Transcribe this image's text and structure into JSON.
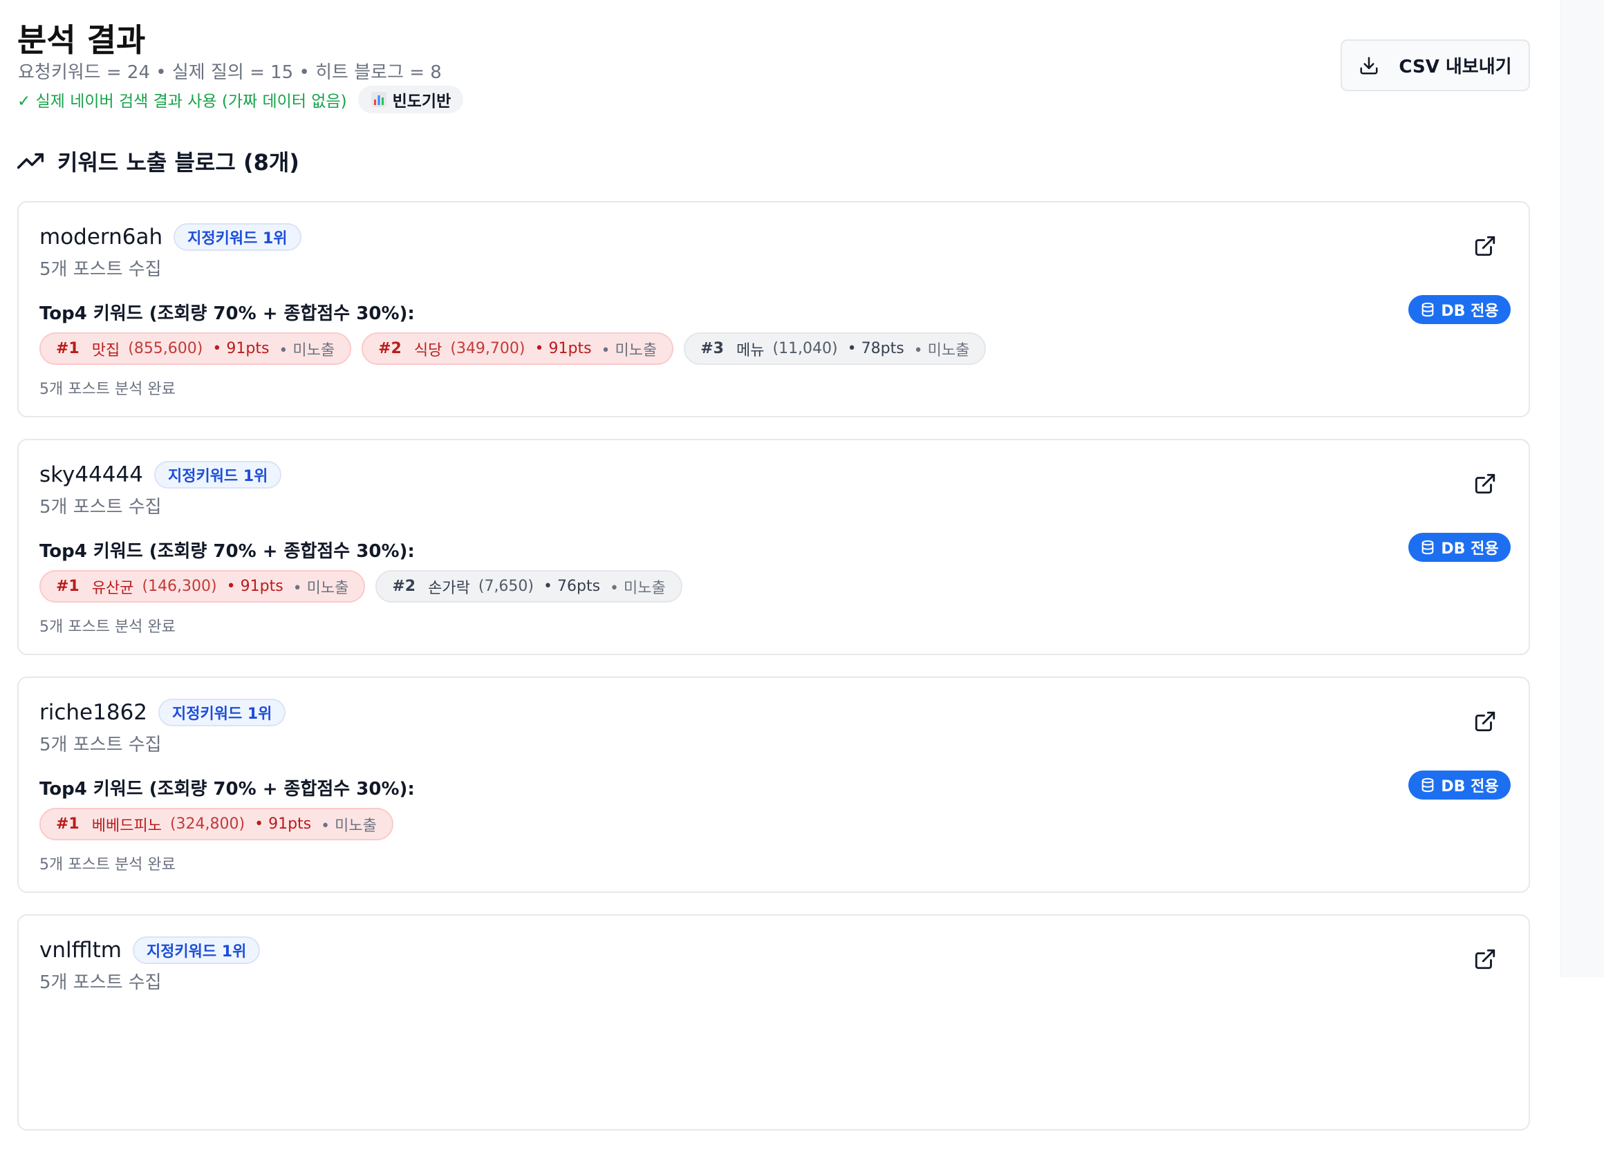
{
  "header": {
    "title": "분석 결과",
    "stats": "요청키워드 = 24 • 실제 질의 = 15 • 히트 블로그 = 8",
    "real_data_note": "✓ 실제 네이버 검색 결과 사용 (가짜 데이터 없음)",
    "frequency_chip": "빈도기반",
    "csv_button": "CSV 내보내기"
  },
  "section": {
    "title": "키워드 노출 블로그 (8개)",
    "icon": "trending-up-icon"
  },
  "blogs": [
    {
      "id": "modern6ah",
      "rank_badge": "지정키워드 1위",
      "post_count": "5개 포스트 수집",
      "top4_label": "Top4 키워드 (조회량 70% + 종합점수 30%):",
      "db_badge": "DB 전용",
      "analysis_note": "5개 포스트 분석 완료",
      "keywords": [
        {
          "rank": "#1",
          "name": "맛집",
          "volume": "(855,600)",
          "pts": "• 91pts",
          "exposure": "• 미노출",
          "tone": "red"
        },
        {
          "rank": "#2",
          "name": "식당",
          "volume": "(349,700)",
          "pts": "• 91pts",
          "exposure": "• 미노출",
          "tone": "red"
        },
        {
          "rank": "#3",
          "name": "메뉴",
          "volume": "(11,040)",
          "pts": "• 78pts",
          "exposure": "• 미노출",
          "tone": "gray"
        }
      ]
    },
    {
      "id": "sky44444",
      "rank_badge": "지정키워드 1위",
      "post_count": "5개 포스트 수집",
      "top4_label": "Top4 키워드 (조회량 70% + 종합점수 30%):",
      "db_badge": "DB 전용",
      "analysis_note": "5개 포스트 분석 완료",
      "keywords": [
        {
          "rank": "#1",
          "name": "유산균",
          "volume": "(146,300)",
          "pts": "• 91pts",
          "exposure": "• 미노출",
          "tone": "red"
        },
        {
          "rank": "#2",
          "name": "손가락",
          "volume": "(7,650)",
          "pts": "• 76pts",
          "exposure": "• 미노출",
          "tone": "gray"
        }
      ]
    },
    {
      "id": "riche1862",
      "rank_badge": "지정키워드 1위",
      "post_count": "5개 포스트 수집",
      "top4_label": "Top4 키워드 (조회량 70% + 종합점수 30%):",
      "db_badge": "DB 전용",
      "analysis_note": "5개 포스트 분석 완료",
      "keywords": [
        {
          "rank": "#1",
          "name": "베베드피노",
          "volume": "(324,800)",
          "pts": "• 91pts",
          "exposure": "• 미노출",
          "tone": "red"
        }
      ]
    },
    {
      "id": "vnlffltm",
      "rank_badge": "지정키워드 1위",
      "post_count": "5개 포스트 수집",
      "top4_label": "",
      "db_badge": "",
      "analysis_note": "",
      "keywords": []
    }
  ]
}
